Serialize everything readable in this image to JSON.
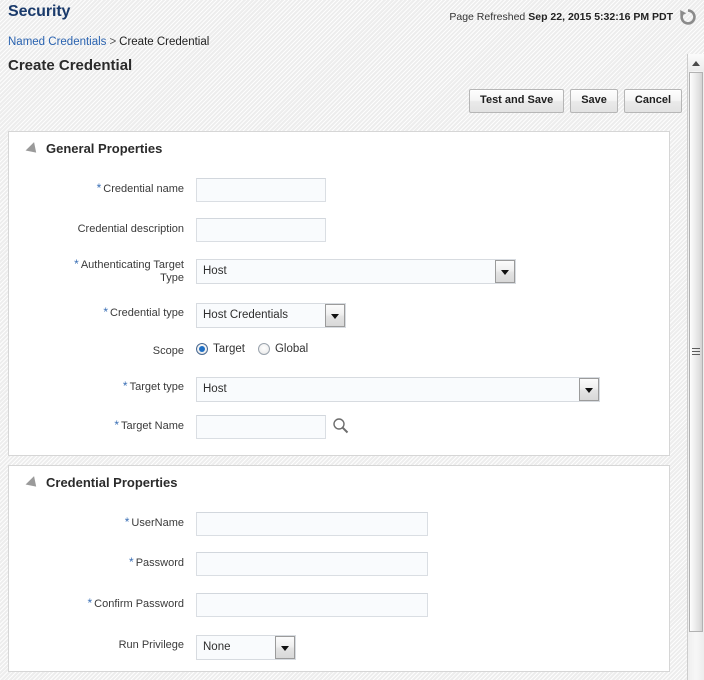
{
  "header": {
    "app_title": "Security",
    "refresh_label": "Page Refreshed",
    "refresh_timestamp": "Sep 22, 2015 5:32:16 PM PDT",
    "refresh_icon": "refresh-circular-arrow-icon"
  },
  "breadcrumb": {
    "parent": "Named Credentials",
    "separator": ">",
    "current": "Create Credential"
  },
  "page_title": "Create Credential",
  "toolbar": {
    "test_and_save_label": "Test and Save",
    "save_label": "Save",
    "cancel_label": "Cancel"
  },
  "general_properties": {
    "section_title": "General Properties",
    "fields": {
      "credential_name": {
        "label": "Credential name",
        "required": true,
        "value": "",
        "placeholder": ""
      },
      "credential_description": {
        "label": "Credential description",
        "required": false,
        "value": "",
        "placeholder": ""
      },
      "authenticating_target_type": {
        "label_line1": "Authenticating Target",
        "label_line2": "Type",
        "required": true,
        "value": "Host",
        "options": [
          "Host"
        ]
      },
      "credential_type": {
        "label": "Credential type",
        "required": true,
        "value": "Host Credentials",
        "options": [
          "Host Credentials"
        ]
      },
      "scope": {
        "label": "Scope",
        "required": false,
        "selected": "Target",
        "options": [
          "Target",
          "Global"
        ]
      },
      "target_type": {
        "label": "Target type",
        "required": true,
        "value": "Host",
        "options": [
          "Host"
        ]
      },
      "target_name": {
        "label": "Target Name",
        "required": true,
        "value": "",
        "placeholder": "",
        "search_icon": "magnifier-search-icon"
      }
    }
  },
  "credential_properties": {
    "section_title": "Credential Properties",
    "fields": {
      "username": {
        "label": "UserName",
        "required": true,
        "value": "",
        "placeholder": ""
      },
      "password": {
        "label": "Password",
        "required": true,
        "value": "",
        "placeholder": ""
      },
      "confirm_password": {
        "label": "Confirm Password",
        "required": true,
        "value": "",
        "placeholder": ""
      },
      "run_privilege": {
        "label": "Run Privilege",
        "required": false,
        "value": "None",
        "options": [
          "None"
        ]
      }
    }
  },
  "colors": {
    "app_title": "#1a3a6b",
    "link": "#2a63b0",
    "required_star": "#3a6fb5",
    "radio_selected": "#1f6fc4",
    "panel_bg": "#ffffff",
    "page_bg": "#f2f2f2"
  },
  "scrollbar": {
    "orientation": "vertical",
    "up_arrow_icon": "scroll-up-arrow-icon",
    "grip_icon": "scrollbar-grip-icon"
  }
}
